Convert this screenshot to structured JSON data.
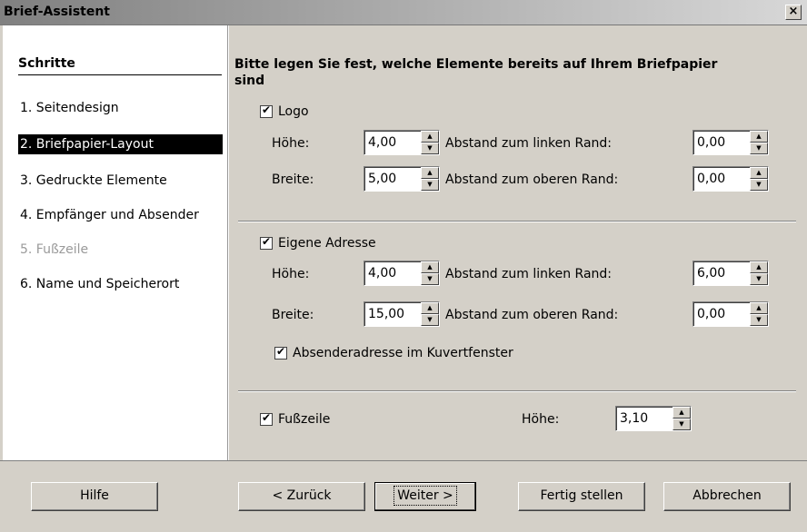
{
  "window": {
    "title": "Brief-Assistent",
    "close_label": "×"
  },
  "sidebar": {
    "heading": "Schritte",
    "steps": [
      {
        "label": "1. Seitendesign"
      },
      {
        "label": "2. Briefpapier-Layout"
      },
      {
        "label": "3. Gedruckte Elemente"
      },
      {
        "label": "4. Empfänger und Absender"
      },
      {
        "label": "5. Fußzeile"
      },
      {
        "label": "6. Name und Speicherort"
      }
    ]
  },
  "main": {
    "instruction": "Bitte legen Sie fest, welche Elemente bereits auf Ihrem Briefpapier sind",
    "logo": {
      "checkbox_label": "Logo",
      "checked": true,
      "height_label": "Höhe:",
      "height_value": "4,00",
      "width_label": "Breite:",
      "width_value": "5,00",
      "left_label": "Abstand zum linken Rand:",
      "left_value": "0,00",
      "top_label": "Abstand zum oberen Rand:",
      "top_value": "0,00"
    },
    "address": {
      "checkbox_label": "Eigene Adresse",
      "checked": true,
      "height_label": "Höhe:",
      "height_value": "4,00",
      "width_label": "Breite:",
      "width_value": "15,00",
      "left_label": "Abstand zum linken Rand:",
      "left_value": "6,00",
      "top_label": "Abstand zum oberen Rand:",
      "top_value": "0,00",
      "envelope_label": "Absenderadresse im Kuvertfenster",
      "envelope_checked": true
    },
    "footer": {
      "checkbox_label": "Fußzeile",
      "checked": true,
      "height_label": "Höhe:",
      "height_value": "3,10"
    }
  },
  "buttons": {
    "help": "Hilfe",
    "back": "< Zurück",
    "next": "Weiter >",
    "finish": "Fertig stellen",
    "cancel": "Abbrechen"
  }
}
